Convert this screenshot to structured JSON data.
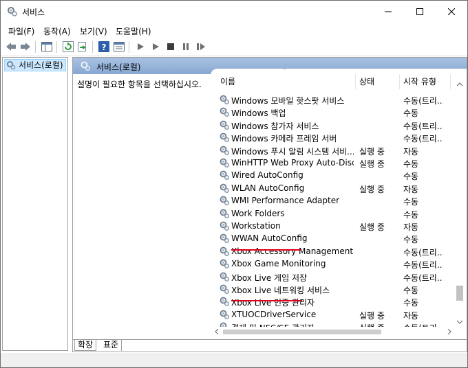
{
  "window": {
    "title": "서비스"
  },
  "menu": [
    "파일(F)",
    "동작(A)",
    "보기(V)",
    "도움말(H)"
  ],
  "toolbar": {
    "buttons": [
      "back-arrow-icon",
      "forward-arrow-icon",
      "show-hide-tree-icon",
      "refresh-icon",
      "export-list-icon",
      "help-icon",
      "properties-icon",
      "start-service-icon",
      "start-service-alt-icon",
      "stop-service-icon",
      "pause-service-icon",
      "restart-service-icon"
    ]
  },
  "tree": {
    "root_label": "서비스(로컬)"
  },
  "pane": {
    "header_title": "서비스(로컬)",
    "description": "설명이 필요한 항목을 선택하십시오."
  },
  "columns": {
    "name": "이름",
    "status": "상태",
    "startup": "시작 유형"
  },
  "services": [
    {
      "name": "Windows 모바일 핫스팟 서비스",
      "status": "",
      "startup": "수동(트리..."
    },
    {
      "name": "Windows 백업",
      "status": "",
      "startup": "수동"
    },
    {
      "name": "Windows 참가자 서비스",
      "status": "",
      "startup": "수동(트리..."
    },
    {
      "name": "Windows 카메라 프레임 서버",
      "status": "",
      "startup": "수동(트리..."
    },
    {
      "name": "Windows 푸시 알림 시스템 서비...",
      "status": "실행 중",
      "startup": "자동"
    },
    {
      "name": "WinHTTP Web Proxy Auto-Disco...",
      "status": "실행 중",
      "startup": "수동"
    },
    {
      "name": "Wired AutoConfig",
      "status": "",
      "startup": "수동"
    },
    {
      "name": "WLAN AutoConfig",
      "status": "실행 중",
      "startup": "자동"
    },
    {
      "name": "WMI Performance Adapter",
      "status": "",
      "startup": "수동"
    },
    {
      "name": "Work Folders",
      "status": "",
      "startup": "수동"
    },
    {
      "name": "Workstation",
      "status": "실행 중",
      "startup": "자동"
    },
    {
      "name": "WWAN AutoConfig",
      "status": "",
      "startup": "수동"
    },
    {
      "name": "Xbox Accessory Management Ser...",
      "status": "",
      "startup": "수동(트리..."
    },
    {
      "name": "Xbox Game Monitoring",
      "status": "",
      "startup": "수동(트리..."
    },
    {
      "name": "Xbox Live 게임 저장",
      "status": "",
      "startup": "수동(트리..."
    },
    {
      "name": "Xbox Live 네트워킹 서비스",
      "status": "",
      "startup": "수동"
    },
    {
      "name": "Xbox Live 인증 관리자",
      "status": "",
      "startup": "수동"
    },
    {
      "name": "XTUOCDriverService",
      "status": "실행 중",
      "startup": "자동"
    },
    {
      "name": "결제 및 NFC/SE 관리자",
      "status": "실행 중",
      "startup": "수동(트리..."
    }
  ],
  "tabs": [
    "확장",
    "표준"
  ],
  "highlight_color": "#e0001a"
}
